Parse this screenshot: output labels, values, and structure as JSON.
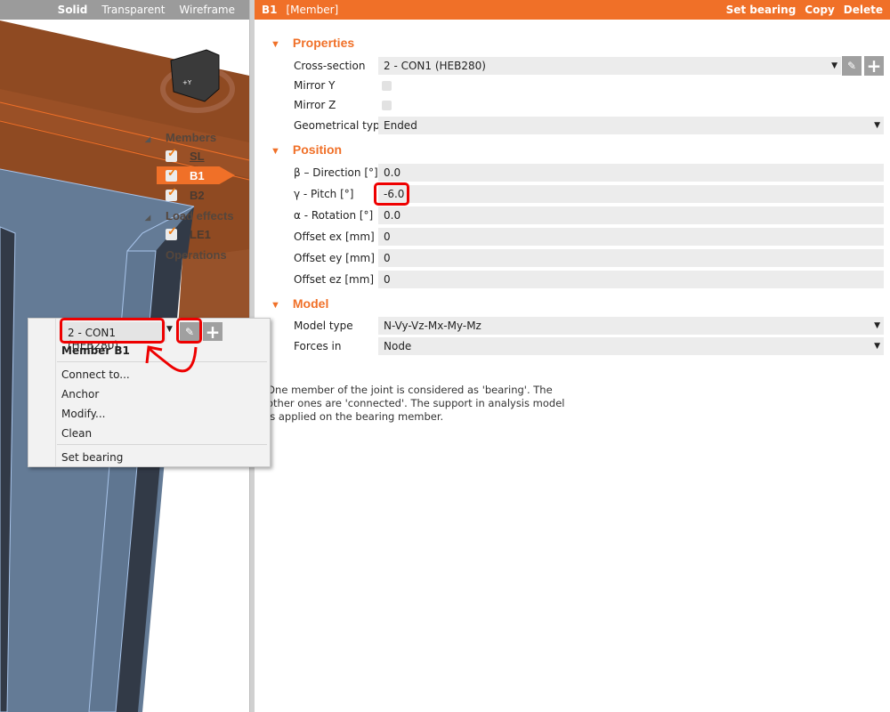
{
  "viewport": {
    "modes": [
      "Solid",
      "Transparent",
      "Wireframe"
    ],
    "active_mode": "Solid",
    "tree": {
      "members_heading": "Members",
      "members": [
        "SL",
        "B1",
        "B2"
      ],
      "selected_member": "B1",
      "load_effects_heading": "Load effects",
      "load_effects": [
        "LE1"
      ],
      "operations_heading": "Operations"
    },
    "cube_label": "+Y"
  },
  "panel": {
    "header": {
      "name": "B1",
      "type": "[Member]",
      "actions": [
        "Set bearing",
        "Copy",
        "Delete"
      ]
    },
    "properties": {
      "title": "Properties",
      "cross_section_label": "Cross-section",
      "cross_section_value": "2 - CON1 (HEB280)",
      "mirror_y_label": "Mirror Y",
      "mirror_z_label": "Mirror Z",
      "geom_type_label": "Geometrical type",
      "geom_type_value": "Ended"
    },
    "position": {
      "title": "Position",
      "rows": [
        {
          "label": "β – Direction [°]",
          "value": "0.0"
        },
        {
          "label": "γ - Pitch [°]",
          "value": "-6.0"
        },
        {
          "label": "α - Rotation [°]",
          "value": "0.0"
        },
        {
          "label": "Offset ex [mm]",
          "value": "0"
        },
        {
          "label": "Offset ey [mm]",
          "value": "0"
        },
        {
          "label": "Offset ez [mm]",
          "value": "0"
        }
      ]
    },
    "model": {
      "title": "Model",
      "model_type_label": "Model type",
      "model_type_value": "N-Vy-Vz-Mx-My-Mz",
      "forces_in_label": "Forces in",
      "forces_in_value": "Node"
    },
    "note": "One member of the joint is considered as 'bearing'. The other ones are 'connected'. The support in analysis model is applied on the bearing member."
  },
  "context_menu": {
    "cross_section": "2 - CON1 (HEB280)",
    "title": "Member B1",
    "items": [
      "Connect to...",
      "Anchor",
      "Modify...",
      "Clean"
    ],
    "last_item": "Set bearing"
  },
  "colors": {
    "accent": "#f07028",
    "annotation": "#e00000"
  }
}
